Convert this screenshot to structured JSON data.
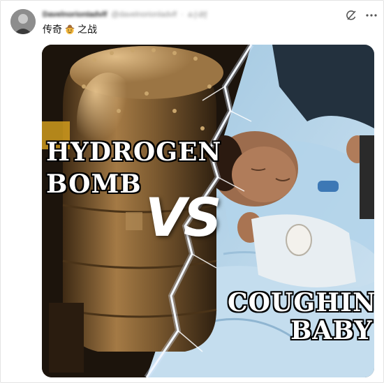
{
  "post": {
    "display_name": "DavelnorionIadvlf",
    "handle": "@davelnorionladvlf",
    "time_separator": "·",
    "timestamp": "4小时",
    "text_before_emoji": "传奇",
    "text_after_emoji": "之战",
    "emoji": "cowboy-hat-emoji-icon"
  },
  "actions": {
    "grok_icon": "grok-icon",
    "more_icon": "more-options-icon"
  },
  "meme": {
    "left_label_line1": "HYDROGEN",
    "left_label_line2": "BOMB",
    "vs": "VS",
    "right_label_line1": "COUGHING",
    "right_label_line2": "BABY"
  },
  "colors": {
    "bomb_brown": "#7a5a2e",
    "blanket_blue": "#b9d6ea",
    "lightning_white": "#ffffff",
    "text_primary": "#111111",
    "text_secondary": "#8a8a8a"
  }
}
